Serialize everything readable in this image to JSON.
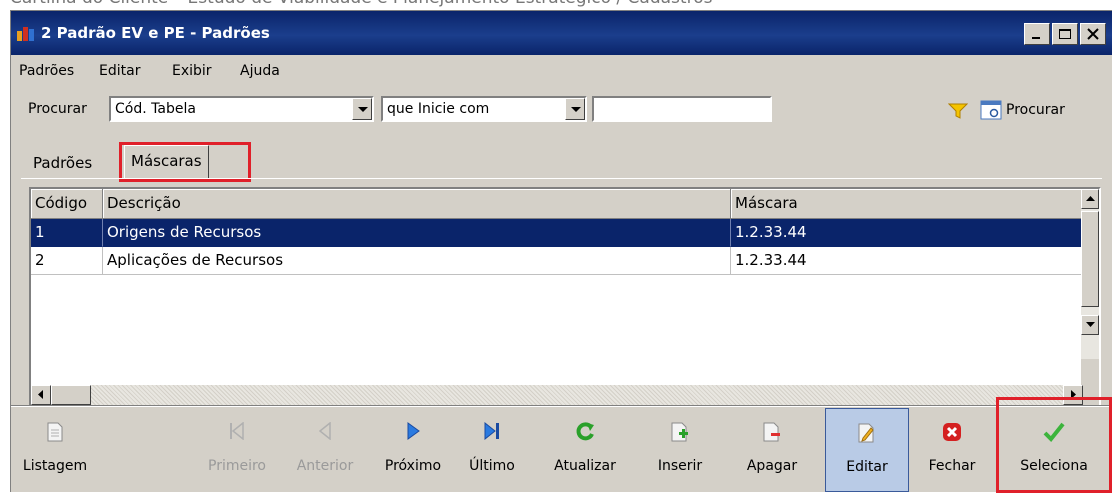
{
  "doc_header": "Cartilha do Cliente – Estudo de Viabilidade e Planejamento Estratégico / Cadastros",
  "window": {
    "title": "2 Padrão EV e PE -  Padrões"
  },
  "menu": [
    {
      "label": "Padrões"
    },
    {
      "label": "Editar"
    },
    {
      "label": "Exibir"
    },
    {
      "label": "Ajuda"
    }
  ],
  "search": {
    "label": "Procurar",
    "field_value": "Cód. Tabela",
    "operator_value": "que Inicie com",
    "text_value": "",
    "button_label": "Procurar"
  },
  "tabs": [
    {
      "label": "Padrões",
      "active": false
    },
    {
      "label": "Máscaras",
      "active": true
    }
  ],
  "grid": {
    "columns": [
      "Código",
      "Descrição",
      "Máscara"
    ],
    "rows": [
      {
        "codigo": "1",
        "descricao": "Origens de Recursos",
        "mascara": "1.2.33.44",
        "selected": true
      },
      {
        "codigo": "2",
        "descricao": "Aplicações de Recursos",
        "mascara": "1.2.33.44",
        "selected": false
      }
    ]
  },
  "toolbar": [
    {
      "label": "Listagem",
      "icon": "document-icon",
      "enabled": true
    },
    {
      "label": "Primeiro",
      "icon": "first-icon",
      "enabled": false
    },
    {
      "label": "Anterior",
      "icon": "previous-icon",
      "enabled": false
    },
    {
      "label": "Próximo",
      "icon": "next-icon",
      "enabled": true
    },
    {
      "label": "Último",
      "icon": "last-icon",
      "enabled": true
    },
    {
      "label": "Atualizar",
      "icon": "refresh-icon",
      "enabled": true
    },
    {
      "label": "Inserir",
      "icon": "insert-icon",
      "enabled": true
    },
    {
      "label": "Apagar",
      "icon": "delete-icon",
      "enabled": true
    },
    {
      "label": "Editar",
      "icon": "edit-icon",
      "enabled": true,
      "pressed": true
    },
    {
      "label": "Fechar",
      "icon": "close-icon",
      "enabled": true
    },
    {
      "label": "Seleciona",
      "icon": "check-icon",
      "enabled": true
    }
  ],
  "colors": {
    "title_bar": "#0a246a",
    "selection": "#0a246a",
    "highlight": "#e0202a",
    "face": "#d4d0c8"
  }
}
